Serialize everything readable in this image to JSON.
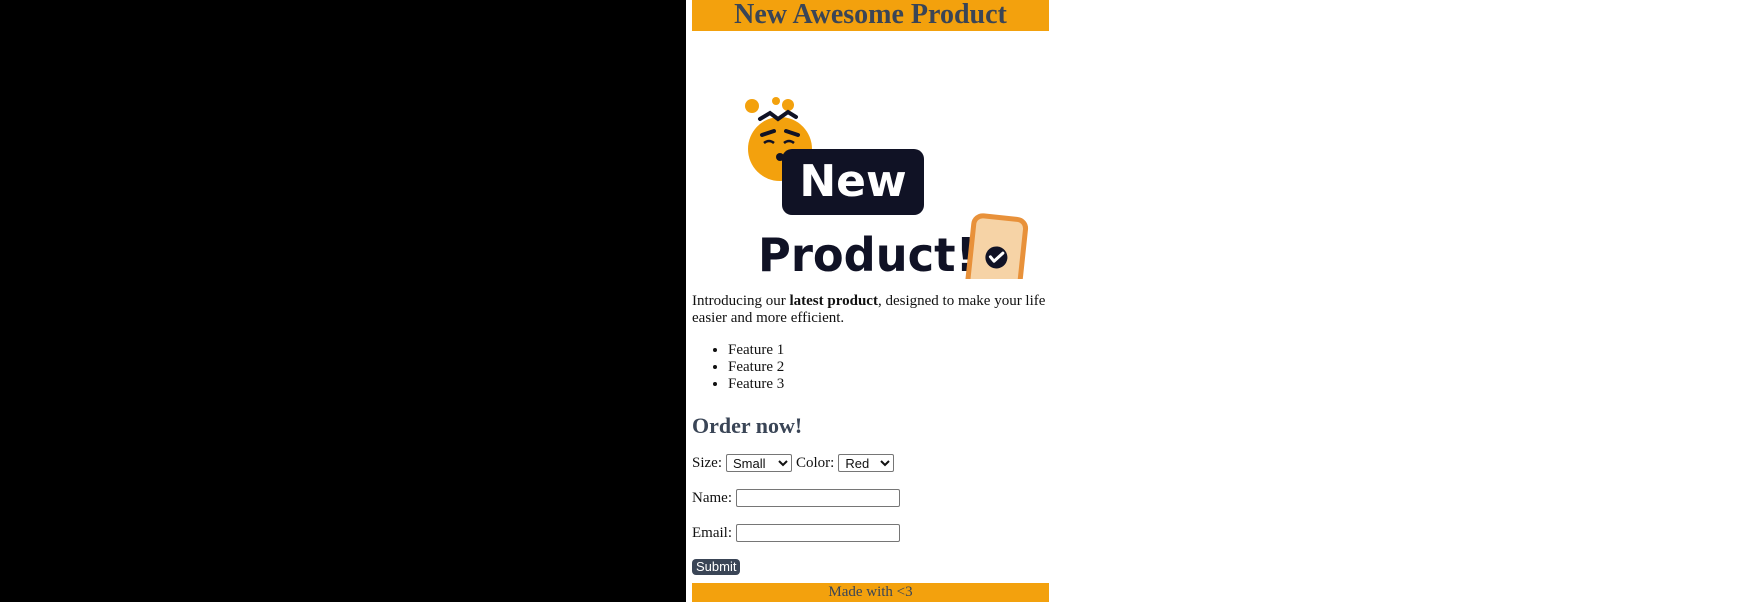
{
  "header": {
    "title": "New Awesome Product"
  },
  "hero": {
    "image_alt": "New Product!",
    "badge_text": "New",
    "headline": "Product!",
    "colors": {
      "orange": "#f3a10d",
      "navy": "#101225",
      "phone": "#f6d3a6"
    }
  },
  "intro": {
    "before": "Introducing our ",
    "bold": "latest product",
    "after": ", designed to make your life easier and more efficient."
  },
  "features": [
    "Feature 1",
    "Feature 2",
    "Feature 3"
  ],
  "order": {
    "title": "Order now!",
    "size_label": "Size:",
    "size_selected": "Small",
    "color_label": "Color:",
    "color_selected": "Red",
    "name_label": "Name:",
    "name_value": "",
    "email_label": "Email:",
    "email_value": "",
    "submit_label": "Submit"
  },
  "footer": {
    "text": "Made with <3"
  },
  "theme": {
    "accent": "#f3a10d",
    "heading": "#3a4556"
  }
}
